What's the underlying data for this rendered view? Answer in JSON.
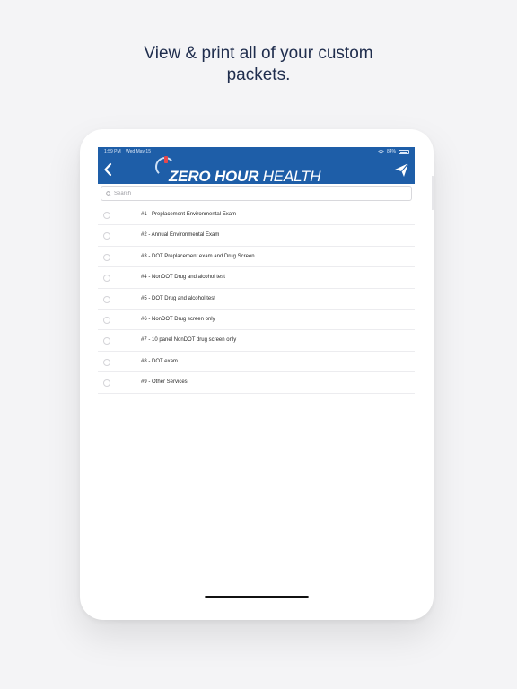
{
  "headline": {
    "line1": "View & print all of your custom",
    "line2": "packets."
  },
  "status_bar": {
    "time": "1:59 PM",
    "day": "Wed May 15",
    "battery": "84%"
  },
  "navbar": {
    "logo_bold": "ZERO HOUR",
    "logo_light": "HEALTH",
    "back_icon": "chevron-left-icon",
    "send_icon": "paper-plane-icon",
    "bar_color": "#1e5ea8"
  },
  "search": {
    "placeholder": "Search",
    "value": ""
  },
  "packets": [
    {
      "label": "#1 - Preplacement Environmental Exam"
    },
    {
      "label": "#2 - Annual Environmental Exam"
    },
    {
      "label": "#3 - DOT Preplacement exam and Drug Screen"
    },
    {
      "label": "#4 - NonDOT Drug and alcohol test"
    },
    {
      "label": "#5 - DOT Drug and alcohol test"
    },
    {
      "label": "#6 - NonDOT Drug screen only"
    },
    {
      "label": "#7 - 10 panel NonDOT drug screen only"
    },
    {
      "label": "#8 - DOT exam"
    },
    {
      "label": "#9 - Other Services"
    }
  ]
}
